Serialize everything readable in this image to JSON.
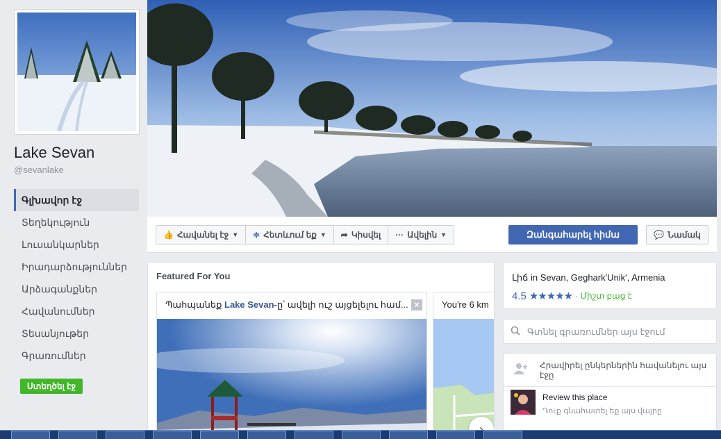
{
  "page": {
    "name": "Lake Sevan",
    "handle": "@sevanlake"
  },
  "nav": {
    "items": [
      {
        "label": "Գլխավոր էջ",
        "active": true
      },
      {
        "label": "Տեղեկություն"
      },
      {
        "label": "Լուսանկարներ"
      },
      {
        "label": "Իրադարձություններ"
      },
      {
        "label": "Արձագանքներ"
      },
      {
        "label": "Հավանումներ"
      },
      {
        "label": "Տեսանյութեր"
      },
      {
        "label": "Գրառումներ"
      }
    ],
    "create_label": "Ստեղծել էջ"
  },
  "actions": {
    "like": "Հավանել էջ",
    "follow": "Հետևում եք",
    "share": "Կիսվել",
    "more": "Ավելին",
    "cta": "Զանգահարել հիմա",
    "message": "Նամակ"
  },
  "featured": {
    "title": "Featured For You",
    "card1_prefix": "Պահպանեք ",
    "card1_highlight": "Lake Sevan",
    "card1_suffix": "-ը՝ ավելի ուշ այցելելու համ...",
    "card2_text": "You're 6 km"
  },
  "about": {
    "category_line": "Լիճ in Sevan, Geghark'Unik', Armenia",
    "rating": "4.5",
    "stars": "★★★★★",
    "open_status": "· Միշտ բաց է"
  },
  "search": {
    "placeholder": "Գտնել գրառումներ այս էջում"
  },
  "invite": {
    "text": "Հրավիրել ընկերներին հավանելու այս էջը"
  },
  "review": {
    "title": "Review this place",
    "subtitle": "Դուք գնահատել եք այս վայրը"
  },
  "colors": {
    "accent": "#4267b2",
    "green": "#42b72a",
    "background": "#e9ebee"
  }
}
